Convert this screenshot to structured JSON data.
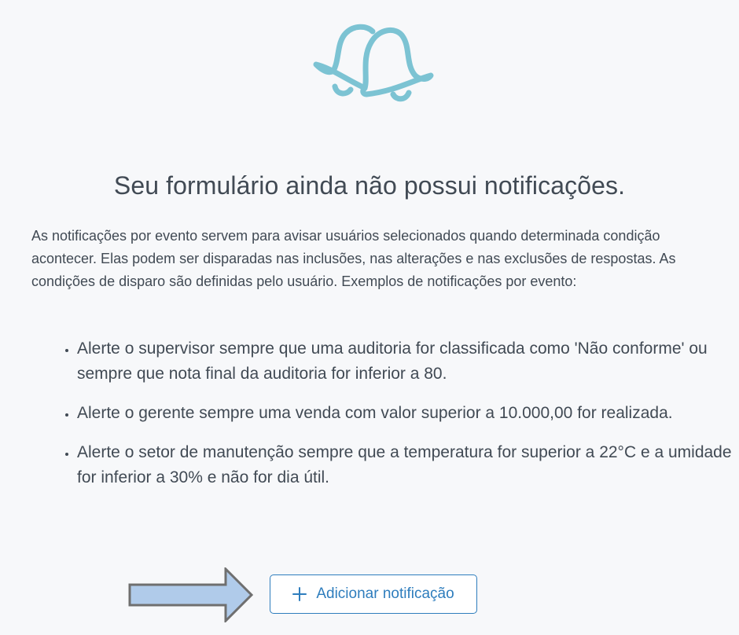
{
  "empty_state": {
    "icon": "bells-icon",
    "icon_color": "#7cc3d3",
    "title": "Seu formulário ainda não possui notificações.",
    "description": "As notificações por evento servem para avisar usuários selecionados quando determinada condição acontecer. Elas podem ser disparadas nas inclusões, nas alterações e nas exclusões de respostas. As condições de disparo são definidas pelo usuário. Exemplos de notificações por evento:",
    "examples": [
      "Alerte o supervisor sempre que uma auditoria for classificada como 'Não conforme' ou sempre que nota final da auditoria for inferior a 80.",
      "Alerte o gerente sempre uma venda com valor superior a 10.000,00 for realizada.",
      "Alerte o setor de manutenção sempre que a temperatura for superior a 22°C e a umidade for inferior a 30% e não for dia útil."
    ]
  },
  "actions": {
    "add_label": "Adicionar notificação",
    "add_icon": "plus-icon",
    "accent_color": "#2e7dbd"
  },
  "annotation": {
    "arrow_icon": "arrow-right-icon",
    "arrow_fill": "#b0cbea",
    "arrow_stroke": "#6f6f6f"
  }
}
